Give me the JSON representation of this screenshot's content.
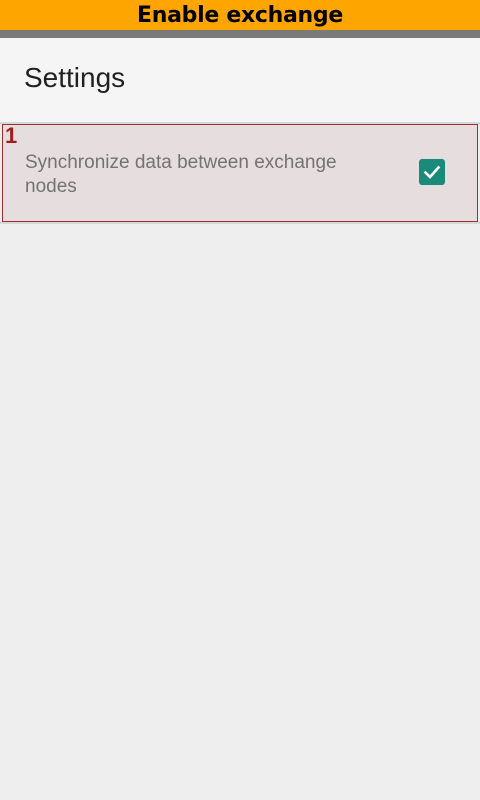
{
  "banner": {
    "label": "Enable exchange",
    "color": "#ffa500"
  },
  "toolbar": {
    "title": "Settings"
  },
  "preferences": [
    {
      "index_label": "1",
      "summary": "Synchronize data between exchange nodes",
      "checked": true,
      "checkbox_color": "#1a8a7a",
      "icon": "check-icon"
    }
  ]
}
